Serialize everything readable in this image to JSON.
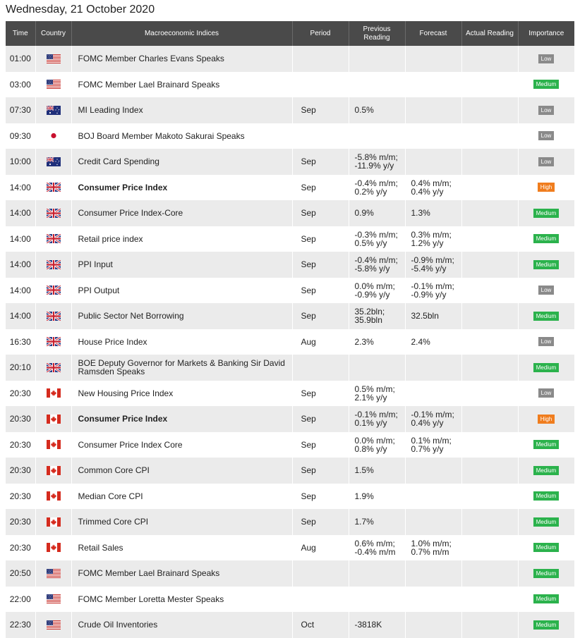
{
  "page": {
    "date_title": "Wednesday, 21 October 2020"
  },
  "table": {
    "headers": {
      "time": "Time",
      "country": "Country",
      "index": "Macroeconomic Indices",
      "period": "Period",
      "previous": "Previous Reading",
      "forecast": "Forecast",
      "actual": "Actual Reading",
      "importance": "Importance"
    },
    "rows": [
      {
        "time": "01:00",
        "country": "us-flag",
        "index": "FOMC Member Charles Evans Speaks",
        "bold": false,
        "period": "",
        "previous": [],
        "forecast": [],
        "actual": "",
        "importance": "Low"
      },
      {
        "time": "03:00",
        "country": "us-flag",
        "index": "FOMC Member Lael Brainard Speaks",
        "bold": false,
        "period": "",
        "previous": [],
        "forecast": [],
        "actual": "",
        "importance": "Medium"
      },
      {
        "time": "07:30",
        "country": "au-flag",
        "index": "MI Leading Index",
        "bold": false,
        "period": "Sep",
        "previous": [
          "0.5%"
        ],
        "forecast": [],
        "actual": "",
        "importance": "Low"
      },
      {
        "time": "09:30",
        "country": "jp-flag",
        "index": "BOJ Board Member Makoto Sakurai Speaks",
        "bold": false,
        "period": "",
        "previous": [],
        "forecast": [],
        "actual": "",
        "importance": "Low"
      },
      {
        "time": "10:00",
        "country": "au-flag",
        "index": "Credit Card Spending",
        "bold": false,
        "period": "Sep",
        "previous": [
          "-5.8% m/m;",
          "-11.9% y/y"
        ],
        "forecast": [],
        "actual": "",
        "importance": "Low"
      },
      {
        "time": "14:00",
        "country": "uk-flag",
        "index": "Consumer Price Index",
        "bold": true,
        "period": "Sep",
        "previous": [
          "-0.4% m/m;",
          "0.2% y/y"
        ],
        "forecast": [
          "0.4% m/m;",
          "0.4% y/y"
        ],
        "actual": "",
        "importance": "High"
      },
      {
        "time": "14:00",
        "country": "uk-flag",
        "index": "Consumer Price Index-Core",
        "bold": false,
        "period": "Sep",
        "previous": [
          "0.9%"
        ],
        "forecast": [
          "1.3%"
        ],
        "actual": "",
        "importance": "Medium"
      },
      {
        "time": "14:00",
        "country": "uk-flag",
        "index": "Retail price index",
        "bold": false,
        "period": "Sep",
        "previous": [
          "-0.3% m/m;",
          "0.5% y/y"
        ],
        "forecast": [
          "0.3% m/m;",
          "1.2% y/y"
        ],
        "actual": "",
        "importance": "Medium"
      },
      {
        "time": "14:00",
        "country": "uk-flag",
        "index": "PPI Input",
        "bold": false,
        "period": "Sep",
        "previous": [
          "-0.4% m/m;",
          "-5.8% y/y"
        ],
        "forecast": [
          "-0.9% m/m;",
          "-5.4% y/y"
        ],
        "actual": "",
        "importance": "Medium"
      },
      {
        "time": "14:00",
        "country": "uk-flag",
        "index": "PPI Output",
        "bold": false,
        "period": "Sep",
        "previous": [
          "0.0% m/m;",
          "-0.9% y/y"
        ],
        "forecast": [
          "-0.1% m/m;",
          "-0.9% y/y"
        ],
        "actual": "",
        "importance": "Low"
      },
      {
        "time": "14:00",
        "country": "uk-flag",
        "index": "Public Sector Net Borrowing",
        "bold": false,
        "period": "Sep",
        "previous": [
          "35.2bln;",
          "35.9bln"
        ],
        "forecast": [
          "32.5bln"
        ],
        "actual": "",
        "importance": "Medium"
      },
      {
        "time": "16:30",
        "country": "uk-flag",
        "index": "House Price Index",
        "bold": false,
        "period": "Aug",
        "previous": [
          "2.3%"
        ],
        "forecast": [
          "2.4%"
        ],
        "actual": "",
        "importance": "Low"
      },
      {
        "time": "20:10",
        "country": "uk-flag",
        "index": "BOE Deputy Governor for Markets & Banking Sir David Ramsden Speaks",
        "bold": false,
        "period": "",
        "previous": [],
        "forecast": [],
        "actual": "",
        "importance": "Medium"
      },
      {
        "time": "20:30",
        "country": "ca-flag",
        "index": "New Housing Price Index",
        "bold": false,
        "period": "Sep",
        "previous": [
          "0.5% m/m;",
          "2.1% y/y"
        ],
        "forecast": [],
        "actual": "",
        "importance": "Low"
      },
      {
        "time": "20:30",
        "country": "ca-flag",
        "index": "Consumer Price Index",
        "bold": true,
        "period": "Sep",
        "previous": [
          "-0.1% m/m;",
          "0.1% y/y"
        ],
        "forecast": [
          "-0.1% m/m;",
          "0.4% y/y"
        ],
        "actual": "",
        "importance": "High"
      },
      {
        "time": "20:30",
        "country": "ca-flag",
        "index": "Consumer Price Index Core",
        "bold": false,
        "period": "Sep",
        "previous": [
          "0.0% m/m;",
          "0.8% y/y"
        ],
        "forecast": [
          "0.1% m/m;",
          "0.7% y/y"
        ],
        "actual": "",
        "importance": "Medium"
      },
      {
        "time": "20:30",
        "country": "ca-flag",
        "index": "Common Core CPI",
        "bold": false,
        "period": "Sep",
        "previous": [
          "1.5%"
        ],
        "forecast": [],
        "actual": "",
        "importance": "Medium"
      },
      {
        "time": "20:30",
        "country": "ca-flag",
        "index": "Median Core CPI",
        "bold": false,
        "period": "Sep",
        "previous": [
          "1.9%"
        ],
        "forecast": [],
        "actual": "",
        "importance": "Medium"
      },
      {
        "time": "20:30",
        "country": "ca-flag",
        "index": "Trimmed Core CPI",
        "bold": false,
        "period": "Sep",
        "previous": [
          "1.7%"
        ],
        "forecast": [],
        "actual": "",
        "importance": "Medium"
      },
      {
        "time": "20:30",
        "country": "ca-flag",
        "index": "Retail Sales",
        "bold": false,
        "period": "Aug",
        "previous": [
          "0.6% m/m;",
          "-0.4% m/m"
        ],
        "forecast": [
          "1.0% m/m;",
          "0.7% m/m"
        ],
        "actual": "",
        "importance": "Medium"
      },
      {
        "time": "20:50",
        "country": "us-flag",
        "index": "FOMC Member Lael Brainard Speaks",
        "bold": false,
        "period": "",
        "previous": [],
        "forecast": [],
        "actual": "",
        "importance": "Medium"
      },
      {
        "time": "22:00",
        "country": "us-flag",
        "index": "FOMC Member Loretta Mester Speaks",
        "bold": false,
        "period": "",
        "previous": [],
        "forecast": [],
        "actual": "",
        "importance": "Medium"
      },
      {
        "time": "22:30",
        "country": "us-flag",
        "index": "Crude Oil Inventories",
        "bold": false,
        "period": "Oct",
        "previous": [
          "-3818K"
        ],
        "forecast": [],
        "actual": "",
        "importance": "Medium"
      }
    ]
  },
  "colors": {
    "header_bg": "#4a4a4a",
    "row_alt_bg": "#ebebeb",
    "badge_low": "#8a8a8a",
    "badge_medium": "#2bb24c",
    "badge_high": "#f07d1e"
  }
}
